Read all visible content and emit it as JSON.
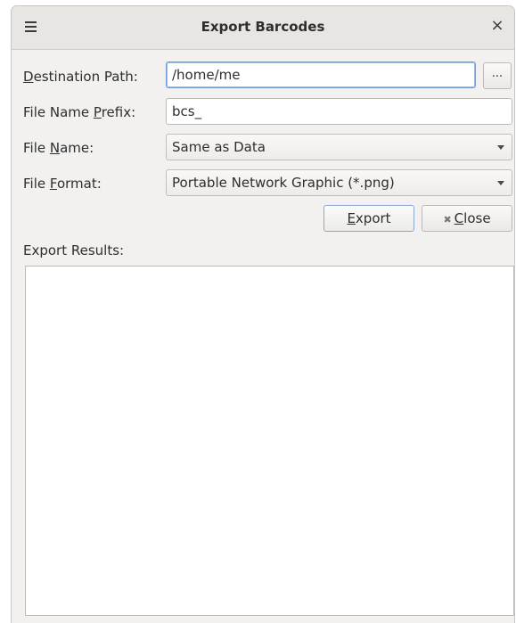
{
  "window": {
    "title": "Export Barcodes",
    "close_glyph": "×"
  },
  "form": {
    "destination": {
      "label_pre": "",
      "label_mnemonic": "D",
      "label_post": "estination Path:",
      "value": "/home/me",
      "browse_label": "..."
    },
    "prefix": {
      "label_pre": "File Name ",
      "label_mnemonic": "P",
      "label_post": "refix:",
      "value": "bcs_"
    },
    "file_name": {
      "label_pre": "File ",
      "label_mnemonic": "N",
      "label_post": "ame:",
      "selected": "Same as Data"
    },
    "file_format": {
      "label_pre": "File ",
      "label_mnemonic": "F",
      "label_post": "ormat:",
      "selected": "Portable Network Graphic (*.png)"
    }
  },
  "buttons": {
    "export_mnemonic": "E",
    "export_rest": "xport",
    "close_icon": "✖",
    "close_mnemonic": "C",
    "close_rest": "lose"
  },
  "results": {
    "label": "Export Results:",
    "content": ""
  }
}
